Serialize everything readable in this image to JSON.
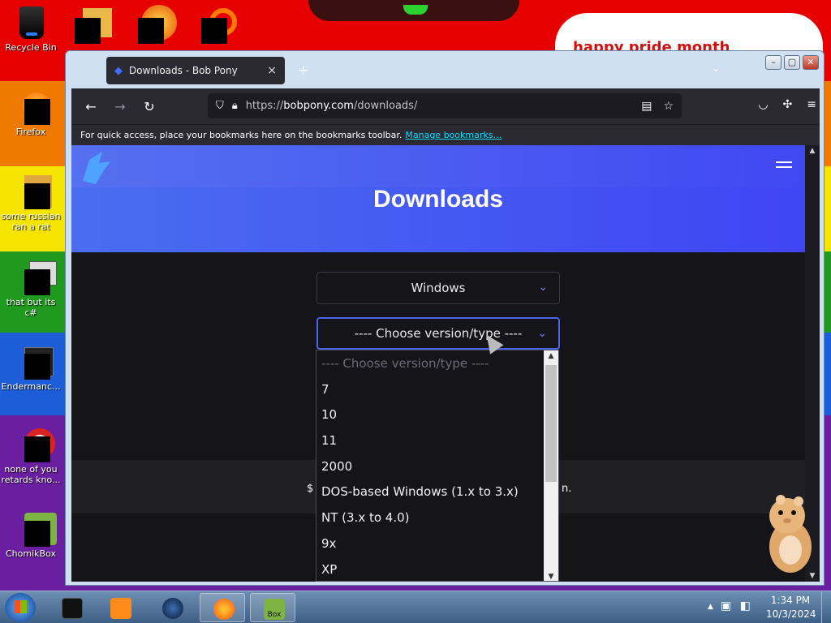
{
  "desktop": {
    "banner_text": "happy pride month",
    "icons": [
      {
        "label": "Recycle Bin"
      },
      {
        "label": "Firefox"
      },
      {
        "label": "some russian ran a rat"
      },
      {
        "label": "that but its c#"
      },
      {
        "label": "Endermanc..."
      },
      {
        "label": "none of you retards kno..."
      },
      {
        "label": "ChomikBox"
      }
    ]
  },
  "window": {
    "controls": [
      "–",
      "▢",
      "✕"
    ]
  },
  "browser": {
    "tab": {
      "title": "Downloads - Bob Pony",
      "close": "×"
    },
    "new_tab": "+",
    "url": {
      "prefix": "https://",
      "domain": "bobpony.com",
      "path": "/downloads/"
    },
    "bookmarks": {
      "text": "For quick access, place your bookmarks here on the bookmarks toolbar.",
      "link": "Manage bookmarks…"
    }
  },
  "page": {
    "title": "Downloads",
    "os_select": {
      "value": "Windows"
    },
    "version_select": {
      "value": "---- Choose version/type ----",
      "options": [
        "---- Choose version/type ----",
        "7",
        "10",
        "11",
        "2000",
        "DOS-based Windows (1.x to 3.x)",
        "NT (3.x to 4.0)",
        "9x",
        "XP"
      ]
    },
    "band_left": "$",
    "band_right": "n."
  },
  "taskbar": {
    "clock_time": "1:34 PM",
    "clock_date": "10/3/2024",
    "chomikbox_label": "Box"
  },
  "colors": {
    "hero_start": "#4a6df0",
    "hero_end": "#3f45f3",
    "link": "#00ddff",
    "page_bg": "#151419"
  }
}
